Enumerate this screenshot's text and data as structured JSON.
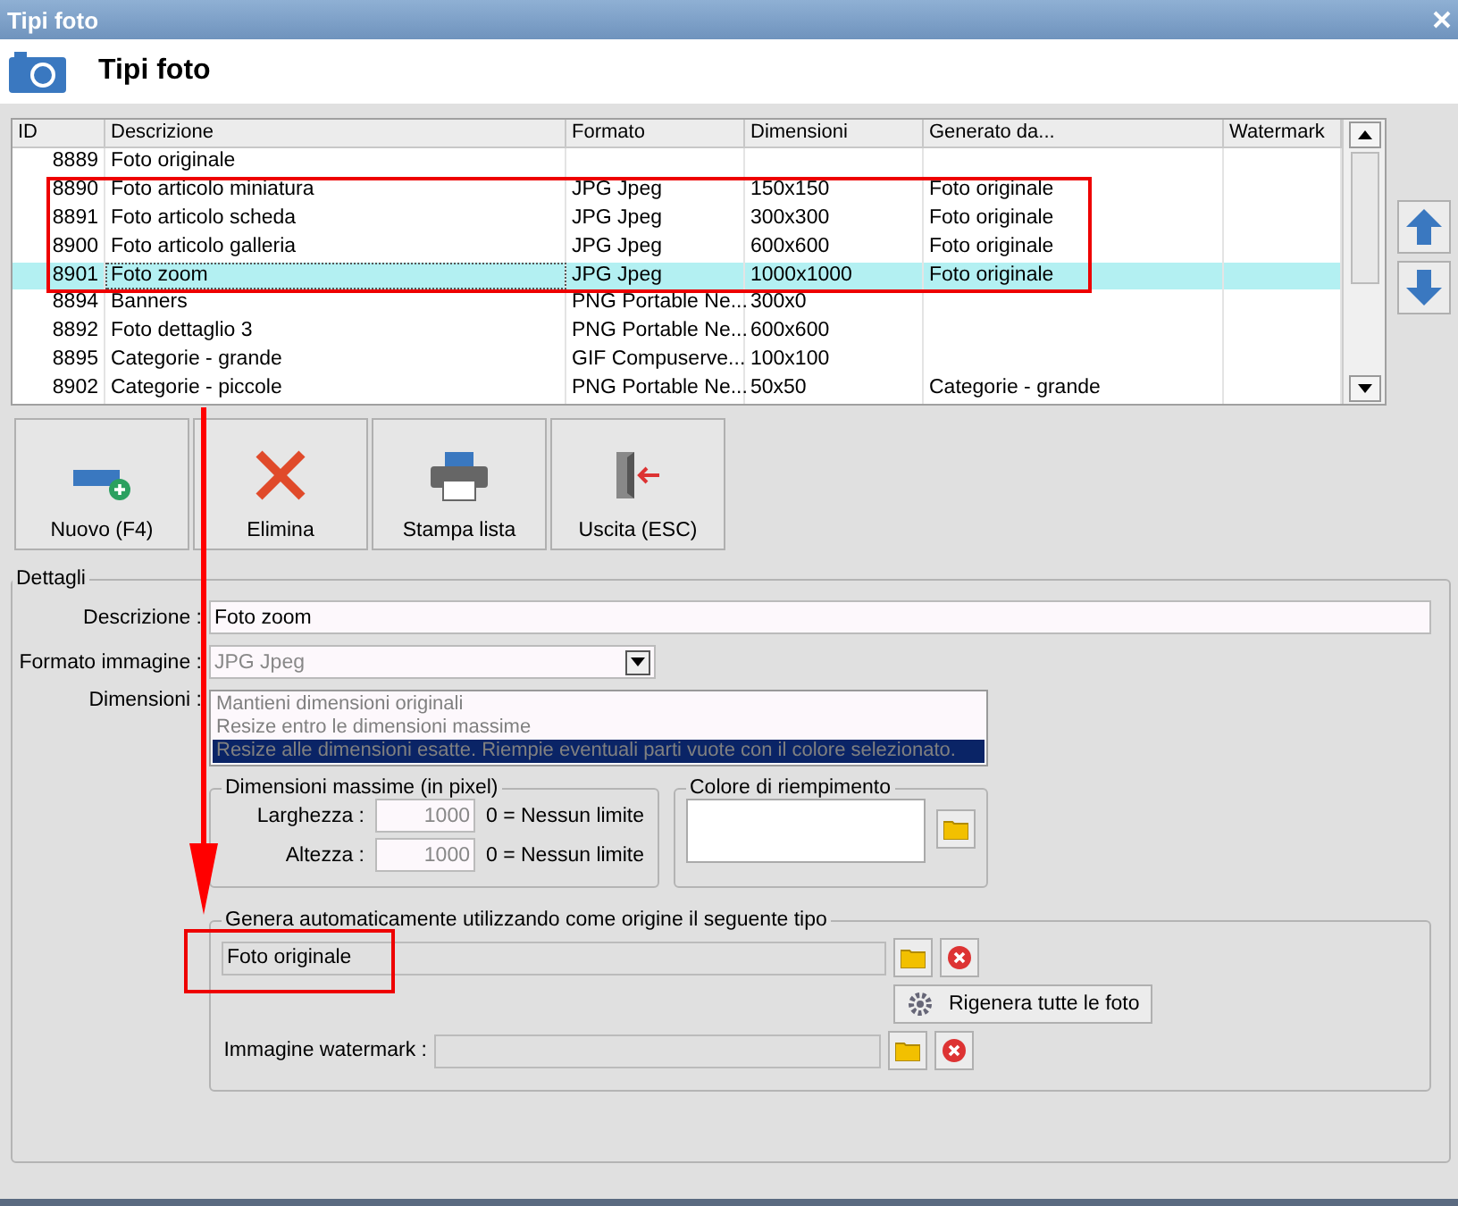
{
  "window": {
    "title": "Tipi foto"
  },
  "header": {
    "title": "Tipi foto"
  },
  "table": {
    "columns": [
      "ID",
      "Descrizione",
      "Formato",
      "Dimensioni",
      "Generato da...",
      "Watermark"
    ],
    "rows": [
      {
        "cells": [
          "8889",
          "Foto originale",
          "",
          "",
          "",
          ""
        ],
        "selected": false
      },
      {
        "cells": [
          "8890",
          "Foto articolo miniatura",
          "JPG Jpeg",
          "150x150",
          "Foto originale",
          ""
        ],
        "selected": false
      },
      {
        "cells": [
          "8891",
          "Foto articolo scheda",
          "JPG Jpeg",
          "300x300",
          "Foto originale",
          ""
        ],
        "selected": false
      },
      {
        "cells": [
          "8900",
          "Foto articolo galleria",
          "JPG Jpeg",
          "600x600",
          "Foto originale",
          ""
        ],
        "selected": false
      },
      {
        "cells": [
          "8901",
          "Foto zoom",
          "JPG Jpeg",
          "1000x1000",
          "Foto originale",
          ""
        ],
        "selected": true
      },
      {
        "cells": [
          "8894",
          "Banners",
          "PNG Portable Ne...",
          "300x0",
          "",
          ""
        ],
        "selected": false
      },
      {
        "cells": [
          "8892",
          "Foto dettaglio 3",
          "PNG Portable Ne...",
          "600x600",
          "",
          ""
        ],
        "selected": false
      },
      {
        "cells": [
          "8895",
          "Categorie - grande",
          "GIF Compuserve...",
          "100x100",
          "",
          ""
        ],
        "selected": false
      },
      {
        "cells": [
          "8902",
          "Categorie - piccole",
          "PNG Portable Ne...",
          "50x50",
          "Categorie - grande",
          ""
        ],
        "selected": false
      }
    ]
  },
  "toolbar": [
    {
      "label": "Nuovo (F4)",
      "kind": "new"
    },
    {
      "label": "Elimina",
      "kind": "delete"
    },
    {
      "label": "Stampa lista",
      "kind": "print"
    },
    {
      "label": "Uscita (ESC)",
      "kind": "exit"
    }
  ],
  "details": {
    "legend": "Dettagli",
    "description": {
      "label": "Descrizione :",
      "value": "Foto zoom"
    },
    "format": {
      "label": "Formato immagine :",
      "value": "JPG Jpeg",
      "disabled": true
    },
    "dimensions": {
      "label": "Dimensioni :",
      "options": [
        {
          "text": "Mantieni dimensioni originali",
          "selected": false
        },
        {
          "text": "Resize entro le dimensioni massime",
          "selected": false
        },
        {
          "text": "Resize alle dimensioni esatte. Riempie eventuali parti vuote con il colore selezionato.",
          "selected": true
        }
      ]
    },
    "max_size": {
      "legend": "Dimensioni massime (in pixel)",
      "fields": [
        {
          "label": "Larghezza :",
          "value": "1000",
          "hint": "0 = Nessun limite",
          "disabled": true
        },
        {
          "label": "Altezza :",
          "value": "1000",
          "hint": "0 = Nessun limite",
          "disabled": true
        }
      ]
    },
    "fill_color": {
      "legend": "Colore di riempimento"
    },
    "auto_generate": {
      "legend": "Genera automaticamente utilizzando come origine il seguente tipo",
      "source": "Foto originale",
      "regenerate_button": "Rigenera tutte le foto",
      "watermark_label": "Immagine watermark :"
    }
  },
  "annotations": [
    {
      "kind": "box"
    },
    {
      "kind": "arrow"
    },
    {
      "kind": "box"
    }
  ]
}
